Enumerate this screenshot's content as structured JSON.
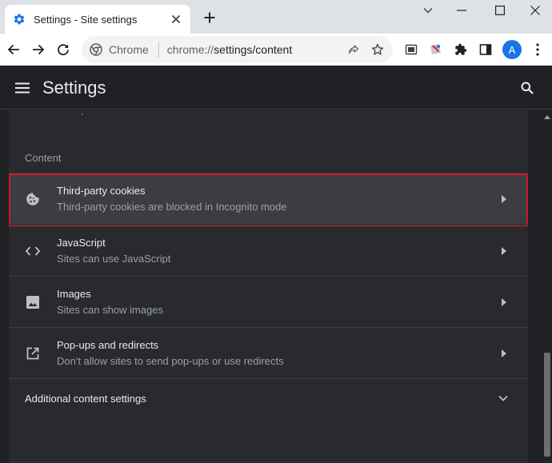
{
  "tab": {
    "title": "Settings - Site settings",
    "favicon": "settings-gear-icon",
    "close_icon": "close-icon",
    "new_tab_icon": "plus-icon"
  },
  "window_controls": [
    "chevron-down-icon",
    "minimize-icon",
    "maximize-icon",
    "close-icon"
  ],
  "toolbar": {
    "back_icon": "arrow-left-icon",
    "forward_icon": "arrow-right-icon",
    "reload_icon": "reload-icon",
    "site_label": "Chrome",
    "url_prefix": "chrome://",
    "url_path": "settings/content",
    "extensions": [
      "share-icon",
      "bookmark-star-icon",
      "screenshot-icon",
      "extension-red-icon",
      "puzzle-icon",
      "sidepanel-icon"
    ],
    "avatar_letter": "A"
  },
  "settings_header": {
    "title": "Settings",
    "menu_icon": "hamburger-menu-icon",
    "search_icon": "search-icon"
  },
  "content": {
    "section_title": "Content",
    "items": [
      {
        "icon": "cookie-icon",
        "title": "Third-party cookies",
        "subtitle": "Third-party cookies are blocked in Incognito mode",
        "highlighted": true
      },
      {
        "icon": "code-brackets-icon",
        "title": "JavaScript",
        "subtitle": "Sites can use JavaScript",
        "highlighted": false
      },
      {
        "icon": "image-icon",
        "title": "Images",
        "subtitle": "Sites can show images",
        "highlighted": false
      },
      {
        "icon": "open-in-new-icon",
        "title": "Pop-ups and redirects",
        "subtitle": "Don't allow sites to send pop-ups or use redirects",
        "highlighted": false
      }
    ],
    "additional_label": "Additional content settings"
  },
  "colors": {
    "highlight_border": "#d0181f",
    "accent_blue": "#1a73e8",
    "dark_bg": "#202124",
    "card_bg": "#292a2d"
  }
}
